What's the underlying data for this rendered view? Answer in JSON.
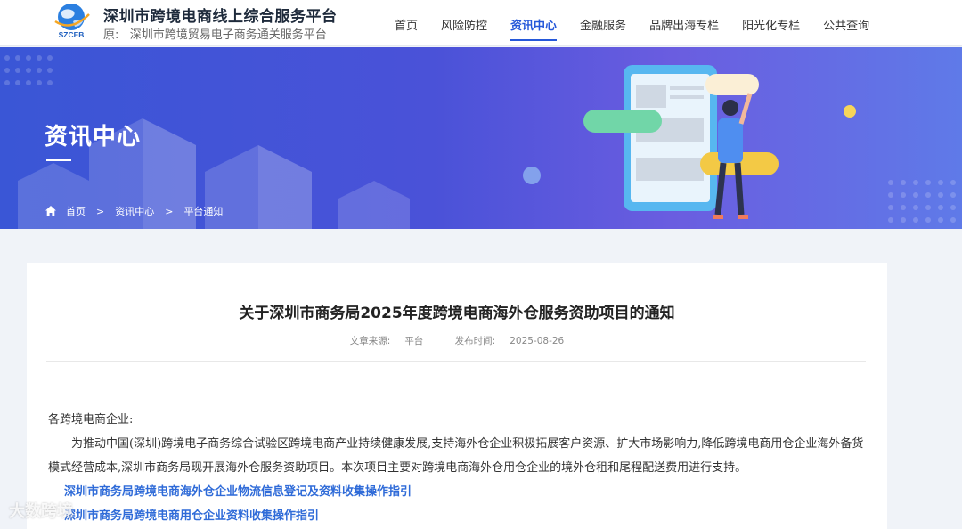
{
  "header": {
    "logo_text": "SZCEB",
    "site_title": "深圳市跨境电商线上综合服务平台",
    "source_prefix": "原:",
    "source_name": "深圳市跨境贸易电子商务通关服务平台",
    "nav": [
      {
        "label": "首页"
      },
      {
        "label": "风险防控"
      },
      {
        "label": "资讯中心",
        "active": true
      },
      {
        "label": "金融服务"
      },
      {
        "label": "品牌出海专栏"
      },
      {
        "label": "阳光化专栏"
      },
      {
        "label": "公共查询"
      }
    ]
  },
  "banner": {
    "title": "资讯中心",
    "breadcrumb": [
      "首页",
      ">",
      "资讯中心",
      ">",
      "平台通知"
    ]
  },
  "article": {
    "title": "关于深圳市商务局2025年度跨境电商海外仓服务资助项目的通知",
    "source_label": "文章来源:",
    "source_value": "平台",
    "date_label": "发布时间:",
    "date_value": "2025-08-26",
    "greeting": "各跨境电商企业:",
    "paragraph": "为推动中国(深圳)跨境电子商务综合试验区跨境电商产业持续健康发展,支持海外仓企业积极拓展客户资源、扩大市场影响力,降低跨境电商用仓企业海外备货模式经营成本,深圳市商务局现开展海外仓服务资助项目。本次项目主要对跨境电商海外仓用仓企业的境外仓租和尾程配送费用进行支持。",
    "links": [
      "深圳市商务局跨境电商海外仓企业物流信息登记及资料收集操作指引",
      "深圳市商务局跨境电商用仓企业资料收集操作指引"
    ]
  },
  "watermark": "大数跨境",
  "colors": {
    "accent": "#2558d9",
    "banner_start": "#3a56d6",
    "banner_end": "#5f7ae8",
    "link": "#2f6bd8"
  }
}
